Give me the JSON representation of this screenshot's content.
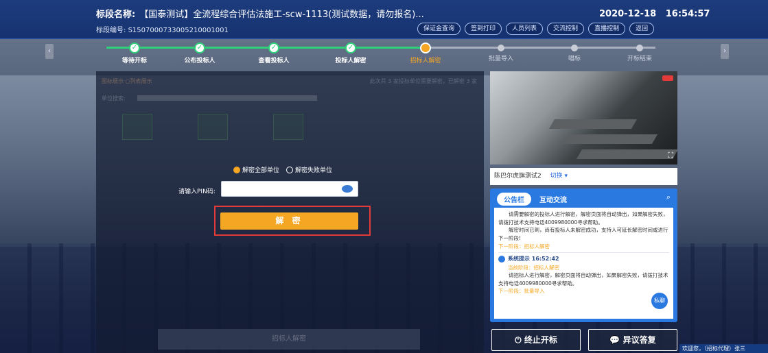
{
  "header": {
    "title_label": "标段名称:",
    "title_value": "【国泰测试】全流程综合评估法施工-scw-1113(测试数据，请勿报名)...",
    "code_label": "标段编号:",
    "code_value": "S1507000733005210001001",
    "date": "2020-12-18",
    "time": "16:54:57",
    "buttons": [
      "保证金查询",
      "签到打印",
      "人员列表",
      "交流控制",
      "直播控制",
      "返回"
    ]
  },
  "steps": [
    {
      "label": "等待开标",
      "state": "done"
    },
    {
      "label": "公布投标人",
      "state": "done"
    },
    {
      "label": "查看投标人",
      "state": "done"
    },
    {
      "label": "投标人解密",
      "state": "done"
    },
    {
      "label": "招标人解密",
      "state": "current"
    },
    {
      "label": "批量导入",
      "state": "todo"
    },
    {
      "label": "唱标",
      "state": "todo"
    },
    {
      "label": "开标结束",
      "state": "todo"
    }
  ],
  "left_panel": {
    "view_toggle": "图标展示 ○列表展示",
    "count_text": "此次共 3 家投标单位需要解密，已解密 3 家",
    "search_label": "单位搜索:",
    "radio_all": "解密全部单位",
    "radio_failed": "解密失败单位",
    "pin_label": "请输入PIN码:",
    "pin_value": "",
    "decrypt_label": "解 密",
    "bottom_label": "招标人解密"
  },
  "camera": {
    "name": "陈巴尔虎旗测试2",
    "switch_label": "切换"
  },
  "notice": {
    "tab_active": "公告栏",
    "tab_other": "互动交流",
    "msg1_p1": "请需要解密的投标人进行解密，解密页面将自动弹出，如果解密失败，请拨打技术支持电话4009980000寻求帮助。",
    "msg1_p2": "解密时间已到，尚有投标人未解密成功，支持人可延长解密时间或进行下一阶段!",
    "msg1_next": "下一阶段：招标人解密",
    "sys_title": "系统提示 16:52:42",
    "sys_current": "当前阶段：招标人解密",
    "sys_p": "请招标人进行解密，解密页面将自动弹出，如果解密失败，请拨打技术支持电话4009980000寻求帮助。",
    "sys_next": "下一阶段：批量导入",
    "chat_label": "私聊"
  },
  "bottom": {
    "stop_label": "⏻ 终止开标",
    "objection_label": "异议答复",
    "welcome": "欢迎您，（招标代理）张三"
  }
}
